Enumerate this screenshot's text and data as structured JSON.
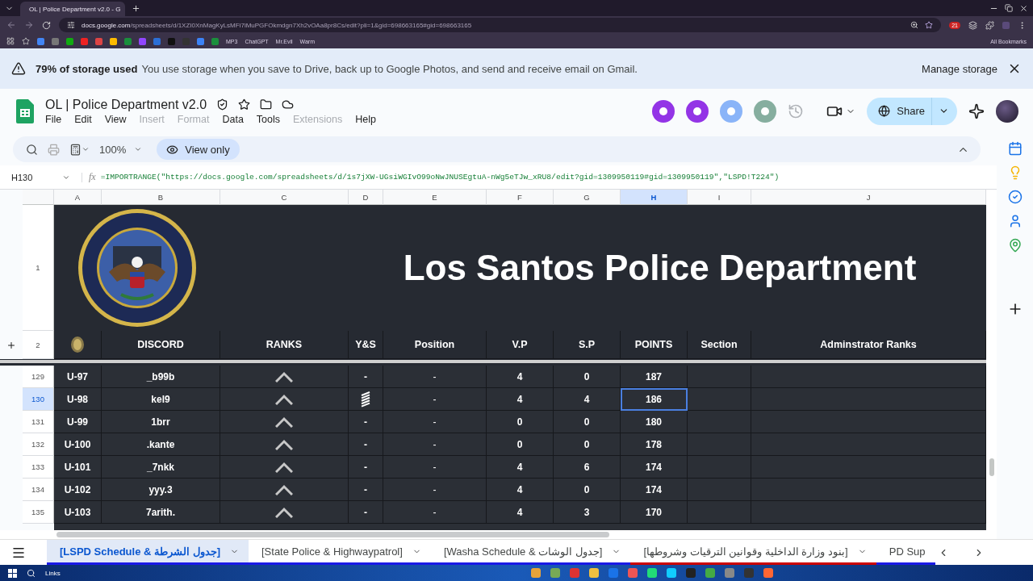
{
  "browser": {
    "tab_title": "OL | Police Department v2.0 - G",
    "url_host": "docs.google.com",
    "url_path": "/spreadsheets/d/1XZI0XnMagKyLsMFi7iMuPGFOkmdgn7Xh2vOAa8pr8Cs/edit?pli=1&gid=698663165#gid=698663165",
    "extension_badge": "21",
    "bookmarks": [
      {
        "label": "MP3"
      },
      {
        "label": "ChatGPT"
      },
      {
        "label": "Mr.Evil"
      },
      {
        "label": "Warm"
      }
    ],
    "all_bookmarks": "All Bookmarks"
  },
  "banner": {
    "usage": "79% of storage used",
    "message": "You use storage when you save to Drive, back up to Google Photos, and send and receive email on Gmail.",
    "action": "Manage storage"
  },
  "doc": {
    "title": "OL | Police Department v2.0",
    "menus": [
      {
        "label": "File",
        "disabled": false
      },
      {
        "label": "Edit",
        "disabled": false
      },
      {
        "label": "View",
        "disabled": false
      },
      {
        "label": "Insert",
        "disabled": true
      },
      {
        "label": "Format",
        "disabled": true
      },
      {
        "label": "Data",
        "disabled": false
      },
      {
        "label": "Tools",
        "disabled": false
      },
      {
        "label": "Extensions",
        "disabled": true
      },
      {
        "label": "Help",
        "disabled": false
      }
    ],
    "collaborators": [
      {
        "color": "#9334e6"
      },
      {
        "color": "#9334e6"
      },
      {
        "color": "#8ab4f8"
      },
      {
        "color": "#86ae9f"
      }
    ],
    "share": "Share"
  },
  "toolbar": {
    "zoom": "100%",
    "mode": "View only"
  },
  "formula_bar": {
    "cell_ref": "H130",
    "fx_label": "fx",
    "formula": "=IMPORTRANGE(\"https://docs.google.com/spreadsheets/d/1s7jXW-UGsiWGIvO99oNwJNUSEgtuA-nWg5eTJw_xRU8/edit?gid=1309950119#gid=1309950119\",\"LSPD!T224\")"
  },
  "columns": [
    {
      "label": "A",
      "selected": false
    },
    {
      "label": "B",
      "selected": false
    },
    {
      "label": "C",
      "selected": false
    },
    {
      "label": "D",
      "selected": false
    },
    {
      "label": "E",
      "selected": false
    },
    {
      "label": "F",
      "selected": false
    },
    {
      "label": "G",
      "selected": false
    },
    {
      "label": "H",
      "selected": true
    },
    {
      "label": "I",
      "selected": false
    },
    {
      "label": "J",
      "selected": false
    }
  ],
  "title_row": {
    "row": "1",
    "title": "Los Santos Police Department"
  },
  "header_row": {
    "row": "2",
    "labels": [
      "DISCORD",
      "RANKS",
      "Y&S",
      "Position",
      "V.P",
      "S.P",
      "POINTS",
      "Section",
      "Adminstrator Ranks"
    ]
  },
  "rows": [
    {
      "row": "129",
      "selected": false,
      "unit": "U-97",
      "discord": "_b99b",
      "ys": {
        "kind": "text",
        "text": "-"
      },
      "position": "-",
      "vp": "4",
      "sp": "0",
      "points": "187"
    },
    {
      "row": "130",
      "selected": true,
      "unit": "U-98",
      "discord": "kel9",
      "ys": {
        "kind": "stripes"
      },
      "position": "-",
      "vp": "4",
      "sp": "4",
      "points": "186"
    },
    {
      "row": "131",
      "selected": false,
      "unit": "U-99",
      "discord": "1brr",
      "ys": {
        "kind": "text",
        "text": "-"
      },
      "position": "-",
      "vp": "0",
      "sp": "0",
      "points": "180"
    },
    {
      "row": "132",
      "selected": false,
      "unit": "U-100",
      "discord": ".kante",
      "ys": {
        "kind": "text",
        "text": "-"
      },
      "position": "-",
      "vp": "0",
      "sp": "0",
      "points": "178"
    },
    {
      "row": "133",
      "selected": false,
      "unit": "U-101",
      "discord": "_7nkk",
      "ys": {
        "kind": "text",
        "text": "-"
      },
      "position": "-",
      "vp": "4",
      "sp": "6",
      "points": "174"
    },
    {
      "row": "134",
      "selected": false,
      "unit": "U-102",
      "discord": "yyy.3",
      "ys": {
        "kind": "text",
        "text": "-"
      },
      "position": "-",
      "vp": "4",
      "sp": "0",
      "points": "174"
    },
    {
      "row": "135",
      "selected": false,
      "unit": "U-103",
      "discord": "7arith.",
      "ys": {
        "kind": "text",
        "text": "-"
      },
      "position": "-",
      "vp": "4",
      "sp": "3",
      "points": "170"
    }
  ],
  "sheet_tabs": [
    {
      "label": "[LSPD Schedule & جدول الشرطة]",
      "selected": true,
      "color": "#1a1ae6"
    },
    {
      "label": "[State Police & Highwaypatrol]",
      "selected": false,
      "color": "#1a1ae6"
    },
    {
      "label": "[Washa Schedule & جدول الوشات]",
      "selected": false,
      "color": "#1a1ae6"
    },
    {
      "label": "[بنود وزارة الداخلية وقوانين الترقيات وشروطها]",
      "selected": false,
      "color": "#cc0000"
    },
    {
      "label": "PD Sup",
      "selected": false,
      "color": "#1a1ae6"
    }
  ],
  "taskbar": {
    "search_label": "Links"
  }
}
